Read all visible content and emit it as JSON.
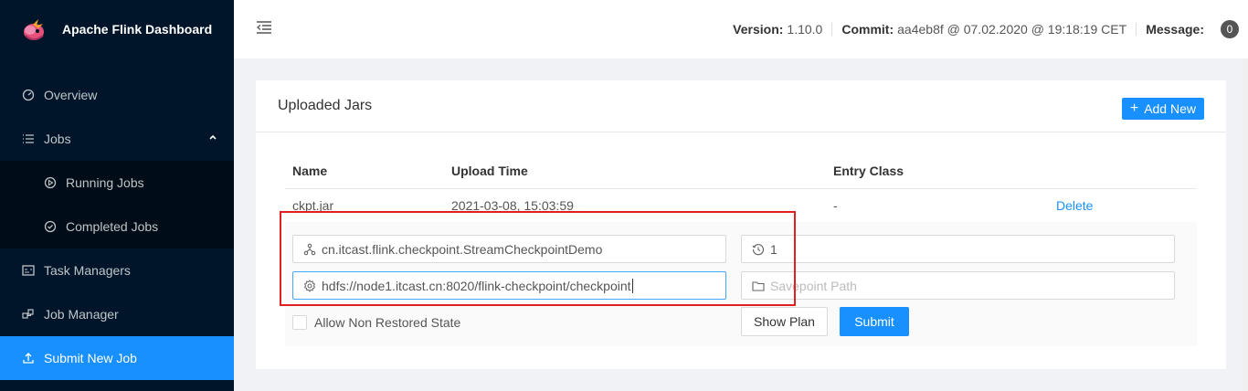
{
  "brand": {
    "title": "Apache Flink Dashboard"
  },
  "sidebar": {
    "items": [
      {
        "label": "Overview",
        "icon": "dashboard-icon"
      },
      {
        "label": "Jobs",
        "icon": "list-icon"
      },
      {
        "label": "Running Jobs",
        "icon": "play-circle-icon"
      },
      {
        "label": "Completed Jobs",
        "icon": "check-circle-icon"
      },
      {
        "label": "Task Managers",
        "icon": "schedule-icon"
      },
      {
        "label": "Job Manager",
        "icon": "cluster-icon"
      },
      {
        "label": "Submit New Job",
        "icon": "upload-icon"
      }
    ]
  },
  "header": {
    "version_label": "Version:",
    "version_value": "1.10.0",
    "commit_label": "Commit:",
    "commit_value": "aa4eb8f @ 07.02.2020 @ 19:18:19 CET",
    "message_label": "Message:",
    "message_count": "0"
  },
  "card": {
    "title": "Uploaded Jars",
    "add_label": "Add New",
    "columns": [
      "Name",
      "Upload Time",
      "Entry Class"
    ],
    "rows": [
      {
        "name": "ckpt.jar",
        "upload_time": "2021-03-08, 15:03:59",
        "entry_class": "-",
        "action": "Delete"
      }
    ]
  },
  "submit_form": {
    "entry_class_value": "cn.itcast.flink.checkpoint.StreamCheckpointDemo",
    "parallelism_value": "1",
    "program_args_value": "hdfs://node1.itcast.cn:8020/flink-checkpoint/checkpoint",
    "savepoint_placeholder": "Savepoint Path",
    "allow_non_restored_label": "Allow Non Restored State",
    "show_plan_label": "Show Plan",
    "submit_label": "Submit"
  },
  "colors": {
    "sidebar_bg": "#001529",
    "accent": "#1890ff",
    "highlight_box": "#e02020"
  }
}
